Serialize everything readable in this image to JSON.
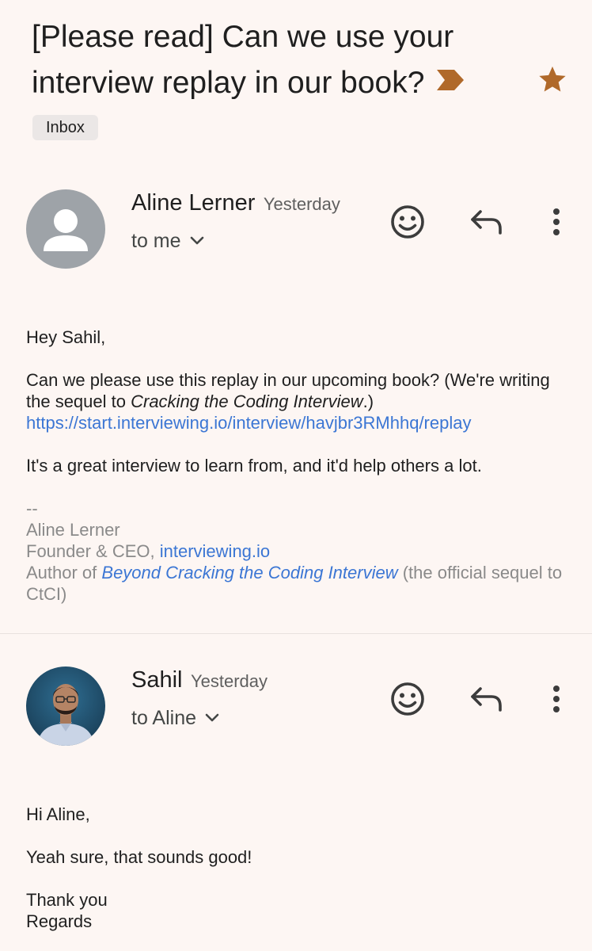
{
  "thread": {
    "subject": "[Please read] Can we use your interview replay in our book?",
    "label": "Inbox",
    "starred": true,
    "important": true,
    "colors": {
      "background": "#fdf6f3",
      "star": "#b0692a",
      "importance_marker": "#b0692a",
      "link": "#3b76d4"
    }
  },
  "messages": [
    {
      "sender": "Aline Lerner",
      "time": "Yesterday",
      "recipient": "to me",
      "avatar": "person-placeholder-icon",
      "body": {
        "greeting": "Hey Sahil,",
        "line1_prefix": "Can we please use this replay in our upcoming book? (We're writing the sequel to ",
        "line1_italic": "Cracking the Coding Interview",
        "line1_suffix": ".)",
        "replay_link": "https://start.interviewing.io/interview/havjbr3RMhhq/replay",
        "line2": "It's a great interview to learn from, and it'd help others a lot."
      },
      "signature": {
        "separator": "--",
        "name": "Aline Lerner",
        "title_prefix": "Founder & CEO, ",
        "company_link": "interviewing.io",
        "author_prefix": "Author of ",
        "book_link": "Beyond Cracking the Coding Interview",
        "author_suffix": " (the official sequel to CtCI)"
      }
    },
    {
      "sender": "Sahil",
      "time": "Yesterday",
      "recipient": "to Aline",
      "avatar": "profile-photo",
      "body": {
        "greeting": "Hi Aline,",
        "line1": "Yeah sure, that sounds good!",
        "closing1": "Thank you",
        "closing2": "Regards"
      }
    }
  ],
  "actions": {
    "emoji": "smiley-icon",
    "reply": "reply-arrow-icon",
    "more": "three-dots-vertical-icon"
  }
}
